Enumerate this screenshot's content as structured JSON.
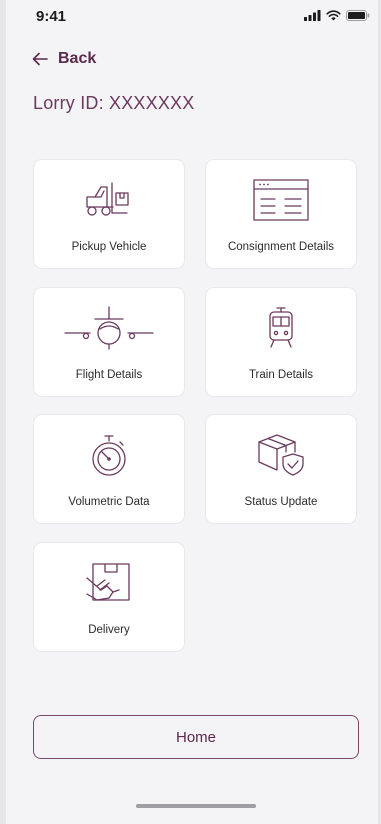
{
  "status_bar": {
    "time": "9:41",
    "icons": [
      "signal-icon",
      "wifi-icon",
      "battery-icon"
    ]
  },
  "header": {
    "back_label": "Back",
    "lorry_id": "Lorry ID: XXXXXXX"
  },
  "cards": [
    {
      "label": "Pickup Vehicle",
      "icon": "forklift-icon"
    },
    {
      "label": "Consignment Details",
      "icon": "document-icon"
    },
    {
      "label": "Flight Details",
      "icon": "airplane-icon"
    },
    {
      "label": "Train Details",
      "icon": "train-icon"
    },
    {
      "label": "Volumetric Data",
      "icon": "stopwatch-icon"
    },
    {
      "label": "Status Update",
      "icon": "shield-box-icon"
    },
    {
      "label": "Delivery",
      "icon": "delivery-icon"
    }
  ],
  "footer": {
    "home_label": "Home"
  },
  "colors": {
    "accent": "#6b3a5e",
    "background": "#f4f3f5",
    "card": "#ffffff"
  }
}
